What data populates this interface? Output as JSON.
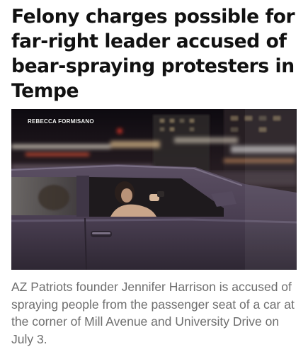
{
  "article": {
    "headline": "Felony charges possible for far-right leader accused of bear-spraying protesters in Tempe",
    "photo_credit": "REBECCA FORMISANO",
    "caption": "AZ Patriots founder Jennifer Harrison is accused of spraying people from the passenger seat of a car at the corner of Mill Avenue and University Drive on July 3."
  },
  "colors": {
    "headline": "#111111",
    "caption": "#6e6e6e",
    "car_body": "#4a3f52"
  }
}
